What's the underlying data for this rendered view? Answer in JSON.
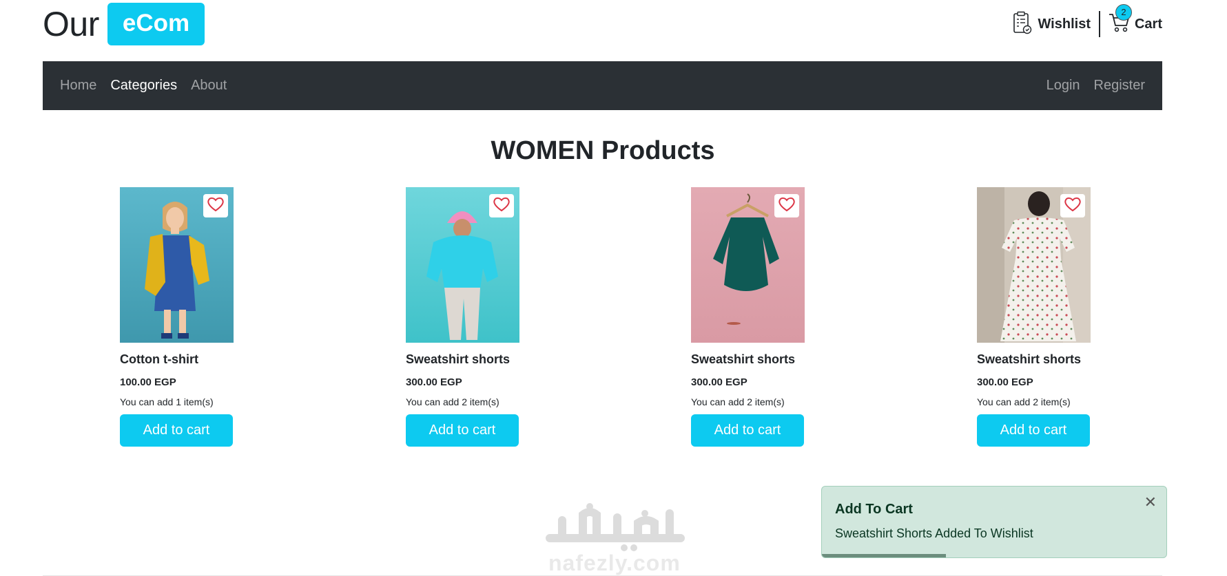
{
  "brand": {
    "text": "Our",
    "badge": "eCom"
  },
  "header": {
    "wishlist_label": "Wishlist",
    "cart_label": "Cart",
    "cart_count": "2"
  },
  "nav": {
    "left": [
      "Home",
      "Categories",
      "About"
    ],
    "active": "Categories",
    "right": [
      "Login",
      "Register"
    ]
  },
  "page_title": "WOMEN Products",
  "products": [
    {
      "name": "Cotton t-shirt",
      "price": "100.00 EGP",
      "limit": "You can add 1 item(s)",
      "button": "Add to cart",
      "photo": "yellow-jacket-blue-dress"
    },
    {
      "name": "Sweatshirt shorts",
      "price": "300.00 EGP",
      "limit": "You can add 2 item(s)",
      "button": "Add to cart",
      "photo": "pink-beanie-cyan-sweater"
    },
    {
      "name": "Sweatshirt shorts",
      "price": "300.00 EGP",
      "limit": "You can add 2 item(s)",
      "button": "Add to cart",
      "photo": "green-dress-on-hanger"
    },
    {
      "name": "Sweatshirt shorts",
      "price": "300.00 EGP",
      "limit": "You can add 2 item(s)",
      "button": "Add to cart",
      "photo": "floral-maxi-dress"
    }
  ],
  "toast": {
    "title": "Add To Cart",
    "message": "Sweatshirt Shorts Added To Wishlist",
    "close_icon": "close-icon",
    "progress": 0.36
  },
  "watermark": {
    "arabic": "نفذلي",
    "latin": "nafezly.com"
  },
  "colors": {
    "accent": "#0dcaf0",
    "navbar": "#2b3035",
    "toast_bg": "#d1e7dd",
    "heart": "#dc3545"
  }
}
